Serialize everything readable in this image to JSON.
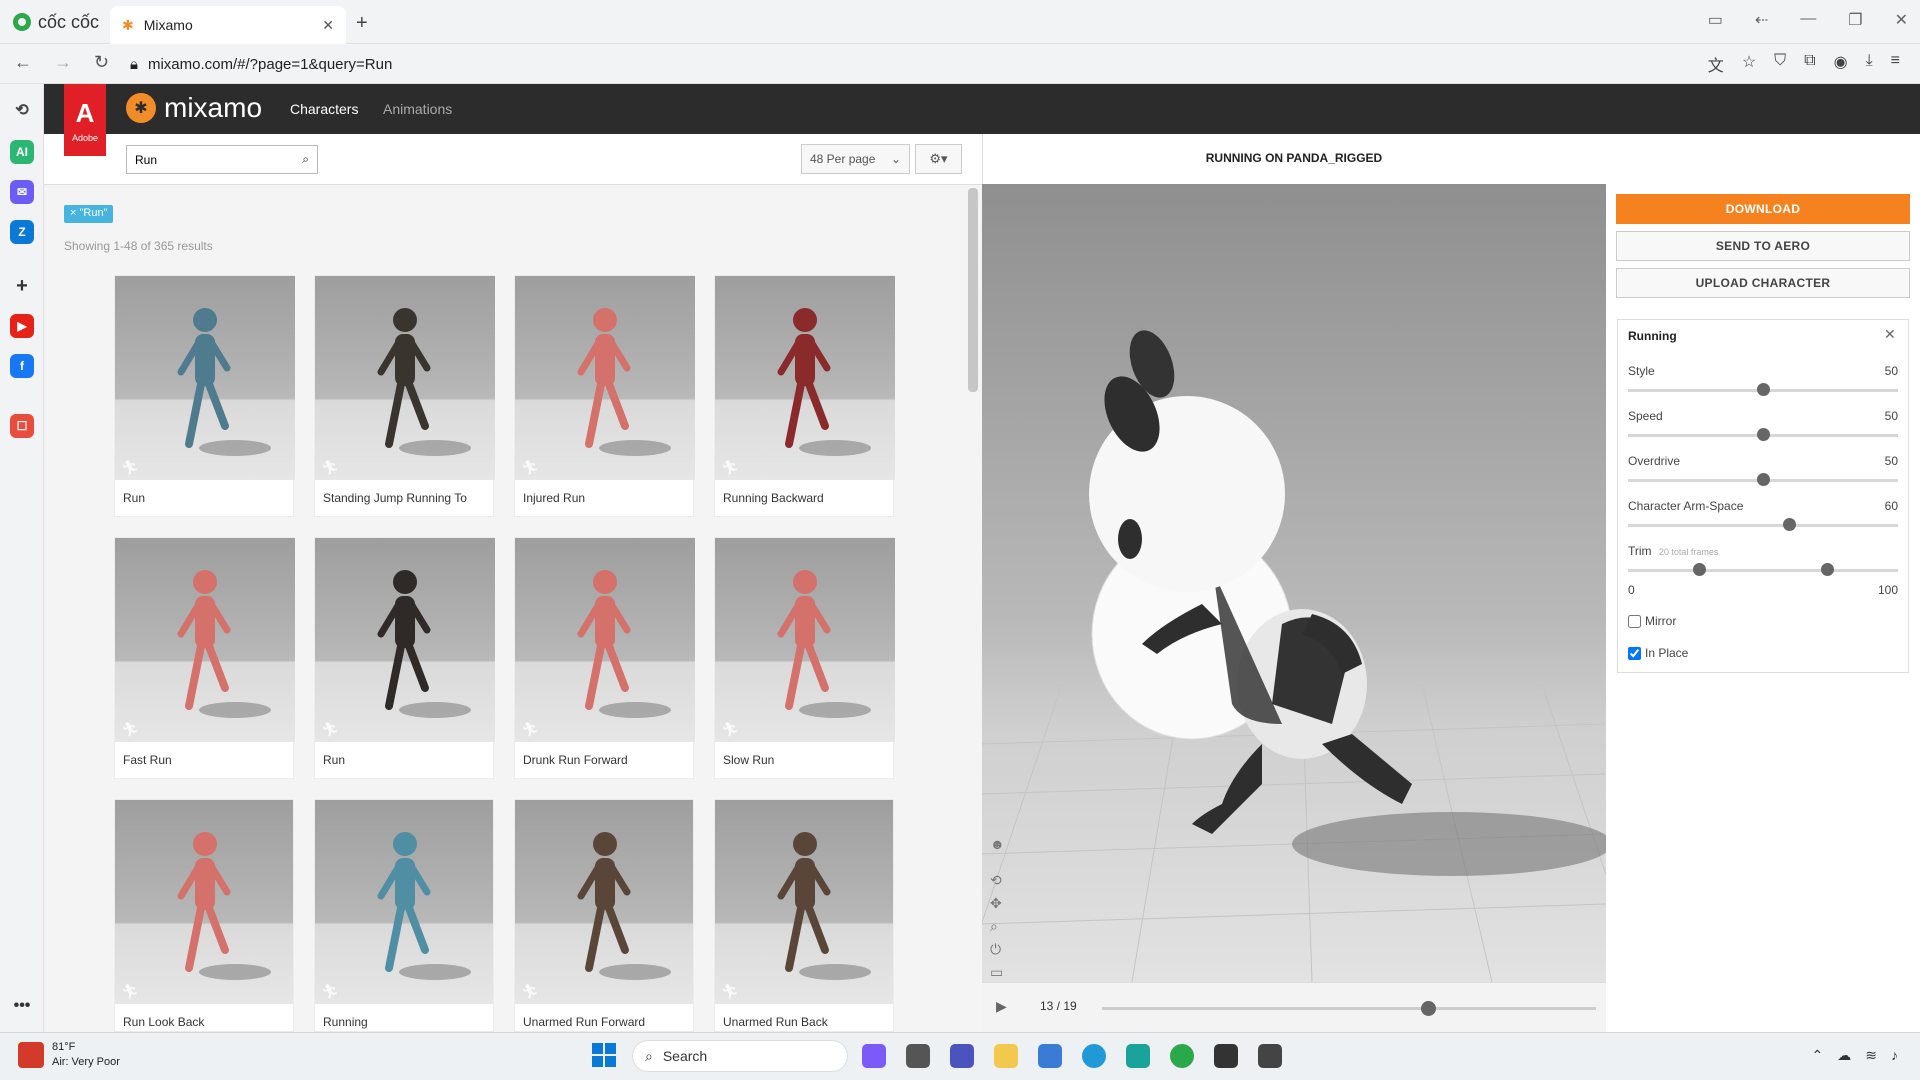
{
  "browser": {
    "brand": "cốc cốc",
    "tab_title": "Mixamo",
    "new_tab": "+",
    "url": "mixamo.com/#/?page=1&query=Run"
  },
  "header": {
    "adobe_label": "Adobe",
    "logo_text": "mixamo",
    "nav_characters": "Characters",
    "nav_animations": "Animations"
  },
  "search": {
    "value": "Run",
    "per_page": "48 Per page"
  },
  "filter_tag": "× \"Run\"",
  "results_info": "Showing 1-48 of 365 results",
  "cards": [
    {
      "label": "Run",
      "color": "#4f7b8f"
    },
    {
      "label": "Standing Jump Running To",
      "color": "#3a342e"
    },
    {
      "label": "Injured Run",
      "color": "#d4716a"
    },
    {
      "label": "Running Backward",
      "color": "#8a2a2a"
    },
    {
      "label": "Fast Run",
      "color": "#d4716a"
    },
    {
      "label": "Run",
      "color": "#2f2a28"
    },
    {
      "label": "Drunk Run Forward",
      "color": "#d4716a"
    },
    {
      "label": "Slow Run",
      "color": "#d4716a"
    },
    {
      "label": "Run Look Back",
      "color": "#d4716a"
    },
    {
      "label": "Running",
      "color": "#4f8ea3"
    },
    {
      "label": "Unarmed Run Forward",
      "color": "#5a4638"
    },
    {
      "label": "Unarmed Run Back",
      "color": "#5a4638"
    }
  ],
  "viewer": {
    "title": "RUNNING ON PANDA_RIGGED",
    "frame_display": "13 / 19",
    "progress": 0.66
  },
  "actions": {
    "download": "DOWNLOAD",
    "send_to_aero": "SEND TO AERO",
    "upload_character": "UPLOAD CHARACTER"
  },
  "params": {
    "title": "Running",
    "style": {
      "label": "Style",
      "value": "50"
    },
    "speed": {
      "label": "Speed",
      "value": "50"
    },
    "overdrive": {
      "label": "Overdrive",
      "value": "50"
    },
    "arm_space": {
      "label": "Character Arm-Space",
      "value": "60"
    },
    "trim": {
      "label": "Trim",
      "note": "20 total frames",
      "min": "0",
      "max": "100",
      "start": 25,
      "end": 75
    },
    "mirror": {
      "label": "Mirror",
      "checked": false
    },
    "in_place": {
      "label": "In Place",
      "checked": true
    }
  },
  "taskbar": {
    "temp": "81°F",
    "air": "Air: Very Poor",
    "search": "Search"
  },
  "colors": {
    "accent_orange": "#f6821f",
    "adobe_red": "#e01f26",
    "header_dark": "#2c2c2c",
    "tag_blue": "#45b5e0"
  }
}
